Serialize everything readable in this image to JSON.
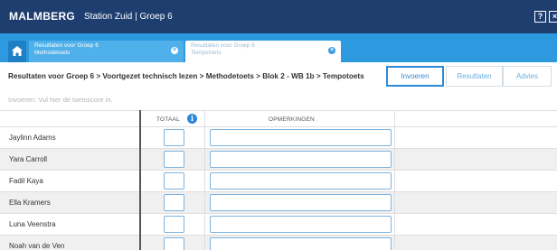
{
  "header": {
    "logo": "MALMBERG",
    "school": "Station Zuid  |  Groep 6",
    "help_label": "?",
    "close_label": "×"
  },
  "tabs": [
    {
      "line1": "Resultaten voor Groep 6",
      "line2": "Methodetoets",
      "close": "×"
    },
    {
      "line1": "Resultaten voor Groep 6",
      "line2": "Tempotoets",
      "close": "×"
    }
  ],
  "breadcrumb": "Resultaten voor Groep 6 > Voortgezet technisch lezen > Methodetoets > Blok 2 - WB 1b > Tempotoets",
  "view_buttons": {
    "enter": "Invoeren",
    "results": "Resultaten",
    "advice": "Advies"
  },
  "instruction": "Invoeren: Vul hier de toetsscore in.",
  "table": {
    "headers": {
      "total": "TOTAAL",
      "remarks": "OPMERKINGEN",
      "info_icon": "i"
    },
    "students": [
      "Jaylinn Adams",
      "Yara Carroll",
      "Fadil Kaya",
      "Ella Kramers",
      "Luna Veenstra",
      "Noah van de Ven"
    ]
  },
  "colors": {
    "topbar": "#1e3e6f",
    "tabbar": "#2d9ae0",
    "accent": "#2d8ad8"
  }
}
